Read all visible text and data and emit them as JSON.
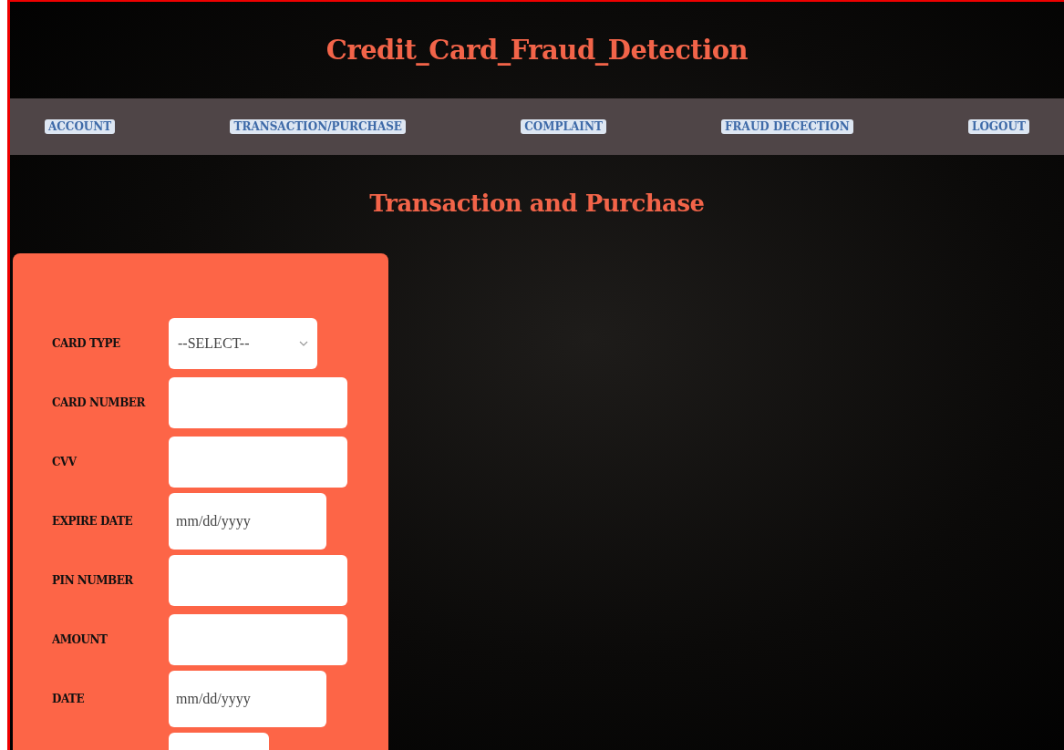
{
  "header": {
    "title": "Credit_Card_Fraud_Detection"
  },
  "nav": [
    {
      "label": "ACCOUNT"
    },
    {
      "label": "TRANSACTION/PURCHASE"
    },
    {
      "label": "COMPLAINT"
    },
    {
      "label": "FRAUD DECECTION"
    },
    {
      "label": "LOGOUT"
    }
  ],
  "page_title": "Transaction and Purchase",
  "form": {
    "fields": [
      {
        "kind": "select",
        "label": "CARD TYPE",
        "value": "--SELECT--"
      },
      {
        "kind": "text",
        "label": "CARD NUMBER"
      },
      {
        "kind": "text",
        "label": "CVV"
      },
      {
        "kind": "date",
        "label": "EXPIRE DATE",
        "placeholder": "mm/dd/yyyy"
      },
      {
        "kind": "text",
        "label": "PIN NUMBER"
      },
      {
        "kind": "text",
        "label": "AMOUNT"
      },
      {
        "kind": "date",
        "label": "DATE",
        "placeholder": "mm/dd/yyyy"
      },
      {
        "kind": "short"
      }
    ]
  }
}
